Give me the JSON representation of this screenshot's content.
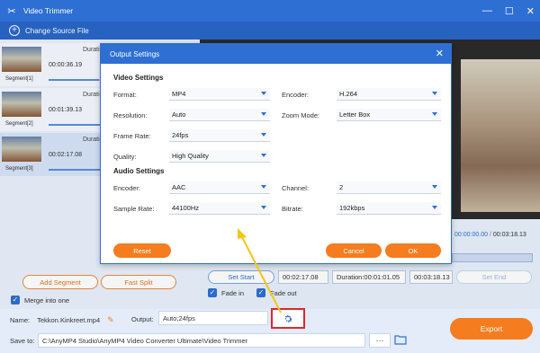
{
  "app": {
    "title": "Video Trimmer"
  },
  "window_controls": {
    "minimize": "—",
    "maximize": "☐",
    "close": "✕"
  },
  "source": {
    "label": "Change Source File"
  },
  "segments": [
    {
      "label": "Segment[1]",
      "duration_header": "Durati",
      "time": "00:00:36.19",
      "progress": 0.35
    },
    {
      "label": "Segment[2]",
      "duration_header": "Durati",
      "time": "00:01:39.13",
      "progress": 0.6
    },
    {
      "label": "Segment[3]",
      "duration_header": "Durati",
      "time": "00:02:17.08",
      "progress": 0.85
    }
  ],
  "left_buttons": {
    "add_segment": "Add Segment",
    "fast_split": "Fast Split"
  },
  "merge": {
    "label": "Merge into one"
  },
  "timer": {
    "current": "00:00:00.00",
    "separator": "/",
    "total": "00:03:18.13"
  },
  "controls": {
    "set_start": "Set Start",
    "start_time": "00:02:17.08",
    "duration": "Duration:00:01:01.05",
    "end_time": "00:03:18.13",
    "set_end": "Set End"
  },
  "fade": {
    "fade_in": "Fade in",
    "fade_out": "Fade out"
  },
  "bottom": {
    "name_label": "Name:",
    "name_value": "Tekkon.Kinkreet.mp4",
    "output_label": "Output:",
    "output_value": "Auto;24fps",
    "save_label": "Save to:",
    "save_path": "C:\\AnyMP4 Studio\\AnyMP4 Video Converter Ultimate\\Video Trimmer",
    "dots": "···",
    "export_label": "Export"
  },
  "dialog": {
    "title": "Output Settings",
    "video_section": "Video Settings",
    "audio_section": "Audio Settings",
    "format_label": "Format:",
    "format_value": "MP4",
    "encoder_label": "Encoder:",
    "encoder_value": "H.264",
    "resolution_label": "Resolution:",
    "resolution_value": "Auto",
    "zoom_label": "Zoom Mode:",
    "zoom_value": "Letter Box",
    "framerate_label": "Frame Rate:",
    "framerate_value": "24fps",
    "quality_label": "Quality:",
    "quality_value": "High Quality",
    "aencoder_label": "Encoder:",
    "aencoder_value": "AAC",
    "channel_label": "Channel:",
    "channel_value": "2",
    "samplerate_label": "Sample Rate:",
    "samplerate_value": "44100Hz",
    "bitrate_label": "Bitrate:",
    "bitrate_value": "192kbps",
    "reset_label": "Reset",
    "cancel_label": "Cancel",
    "ok_label": "OK"
  },
  "colors": {
    "accent": "#2e6fd4",
    "orange": "#f57c1f",
    "highlight": "#e5252a"
  }
}
